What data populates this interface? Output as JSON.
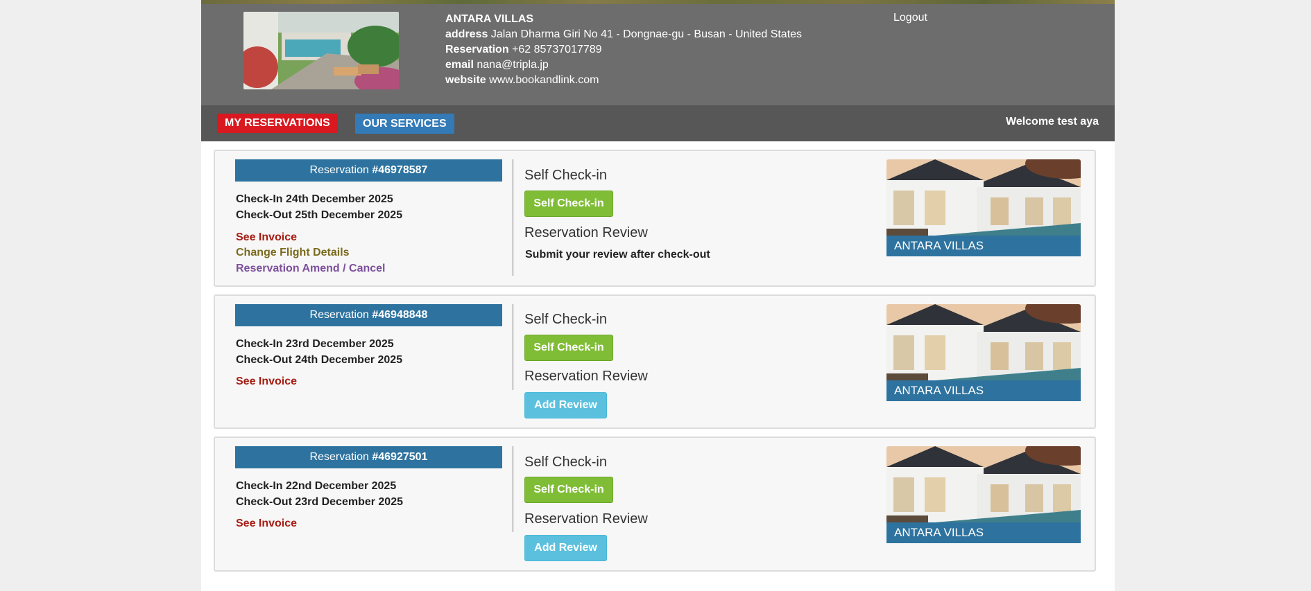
{
  "hotel": {
    "name": "ANTARA VILLAS",
    "address_label": "address",
    "address": "Jalan Dharma Giri No 41 - Dongnae-gu - Busan - United States",
    "reservation_label": "Reservation",
    "phone": "+62 85737017789",
    "email_label": "email",
    "email": "nana@tripla.jp",
    "website_label": "website",
    "website": "www.bookandlink.com"
  },
  "header": {
    "logout": "Logout"
  },
  "nav": {
    "my_reservations": "MY RESERVATIONS",
    "our_services": "OUR SERVICES",
    "welcome": "Welcome test aya"
  },
  "colors": {
    "accent_red": "#d9181f",
    "accent_blue": "#337ab7",
    "header_blue": "#2e739f",
    "green": "#80bd36",
    "light_blue": "#5bc0de"
  },
  "reservations": [
    {
      "prefix": "Reservation ",
      "number": "#46978587",
      "checkin": "Check-In 24th December 2025",
      "checkout": "Check-Out 25th December 2025",
      "see_invoice": "See Invoice",
      "change_flight": "Change Flight Details",
      "amend_cancel": "Reservation Amend / Cancel",
      "self_checkin_title": "Self Check-in",
      "self_checkin_button": "Self Check-in",
      "review_title": "Reservation Review",
      "review_note": "Submit your review after check-out",
      "villa_label": "ANTARA VILLAS"
    },
    {
      "prefix": "Reservation ",
      "number": "#46948848",
      "checkin": "Check-In 23rd December 2025",
      "checkout": "Check-Out 24th December 2025",
      "see_invoice": "See Invoice",
      "self_checkin_title": "Self Check-in",
      "self_checkin_button": "Self Check-in",
      "review_title": "Reservation Review",
      "add_review": "Add Review",
      "villa_label": "ANTARA VILLAS"
    },
    {
      "prefix": "Reservation ",
      "number": "#46927501",
      "checkin": "Check-In 22nd December 2025",
      "checkout": "Check-Out 23rd December 2025",
      "see_invoice": "See Invoice",
      "self_checkin_title": "Self Check-in",
      "self_checkin_button": "Self Check-in",
      "review_title": "Reservation Review",
      "add_review": "Add Review",
      "villa_label": "ANTARA VILLAS"
    }
  ]
}
